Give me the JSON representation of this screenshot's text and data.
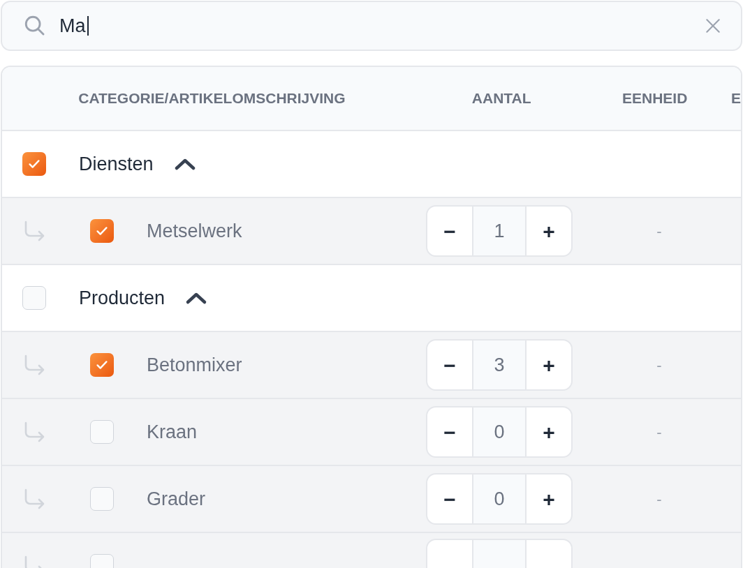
{
  "search": {
    "value": "Ma"
  },
  "table": {
    "columns": [
      "CATEGORIE/ARTIKELOMSCHRIJVING",
      "AANTAL",
      "EENHEID",
      "E"
    ],
    "groups": [
      {
        "name": "Diensten",
        "checked": true,
        "expanded": true,
        "children": [
          {
            "name": "Metselwerk",
            "checked": true,
            "minus": "−",
            "quantity": "1",
            "plus": "+",
            "unit": "-"
          }
        ]
      },
      {
        "name": "Producten",
        "checked": false,
        "expanded": true,
        "children": [
          {
            "name": "Betonmixer",
            "checked": true,
            "minus": "−",
            "quantity": "3",
            "plus": "+",
            "unit": "-"
          },
          {
            "name": "Kraan",
            "checked": false,
            "minus": "−",
            "quantity": "0",
            "plus": "+",
            "unit": "-"
          },
          {
            "name": "Grader",
            "checked": false,
            "minus": "−",
            "quantity": "0",
            "plus": "+",
            "unit": "-"
          },
          {
            "checked": false
          }
        ]
      }
    ]
  }
}
